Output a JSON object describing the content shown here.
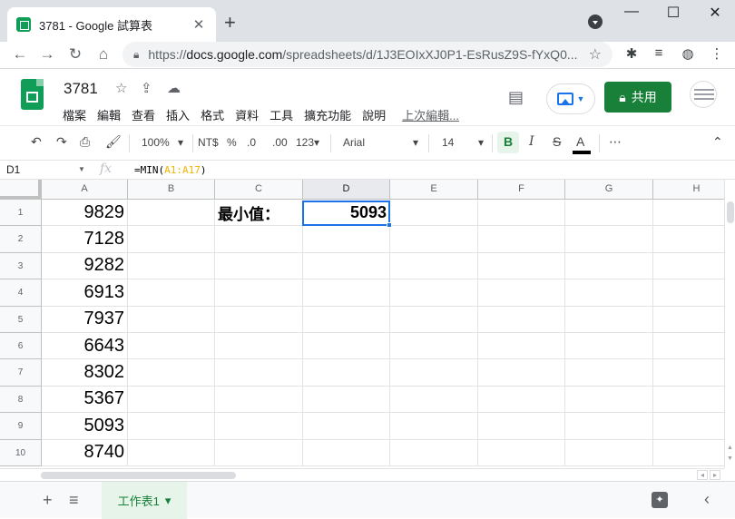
{
  "browser": {
    "tab_title": "3781 - Google 試算表",
    "tab_close": "✕",
    "new_tab": "+",
    "url_host": "docs.google.com",
    "url_path": "/spreadsheets/d/1J3EOIxXJ0P1-EsRusZ9S-fYxQ0...",
    "url_prefix": "https://",
    "window_controls": [
      "—",
      "☐",
      "✕"
    ]
  },
  "app": {
    "doc_title": "3781",
    "menu": [
      "檔案",
      "編輯",
      "查看",
      "插入",
      "格式",
      "資料",
      "工具",
      "擴充功能",
      "說明"
    ],
    "last_edit": "上次編輯...",
    "share_label": "共用"
  },
  "toolbar": {
    "zoom": "100%",
    "currency": "NT$",
    "percent": "%",
    "decimal_decrease": ".0",
    "decimal_increase": ".00",
    "number_format": "123▾",
    "font": "Arial",
    "font_size": "14",
    "bold": "B",
    "italic": "I",
    "strike": "S",
    "text_color": "A",
    "more": "⋯"
  },
  "formula_bar": {
    "name_box": "D1",
    "fx": "fx",
    "formula_prefix": "=MIN(",
    "formula_range": "A1:A17",
    "formula_suffix": ")"
  },
  "grid": {
    "columns": [
      "A",
      "B",
      "C",
      "D",
      "E",
      "F",
      "G",
      "H"
    ],
    "rows": [
      "1",
      "2",
      "3",
      "4",
      "5",
      "6",
      "7",
      "8",
      "9",
      "10"
    ],
    "col_a_values": [
      "9829",
      "7128",
      "9282",
      "6913",
      "7937",
      "6643",
      "8302",
      "5367",
      "5093",
      "8740"
    ],
    "c1_label": "最小值：",
    "d1_value": "5093",
    "selected_cell": "D1"
  },
  "sheets": {
    "add": "+",
    "all_sheets": "≡",
    "active_tab": "工作表1",
    "tab_caret": "▾"
  },
  "colors": {
    "sheets_green": "#0f9d58",
    "share_green": "#188038",
    "selection_blue": "#1a73e8",
    "range_ref_yellow": "#f4b400"
  }
}
